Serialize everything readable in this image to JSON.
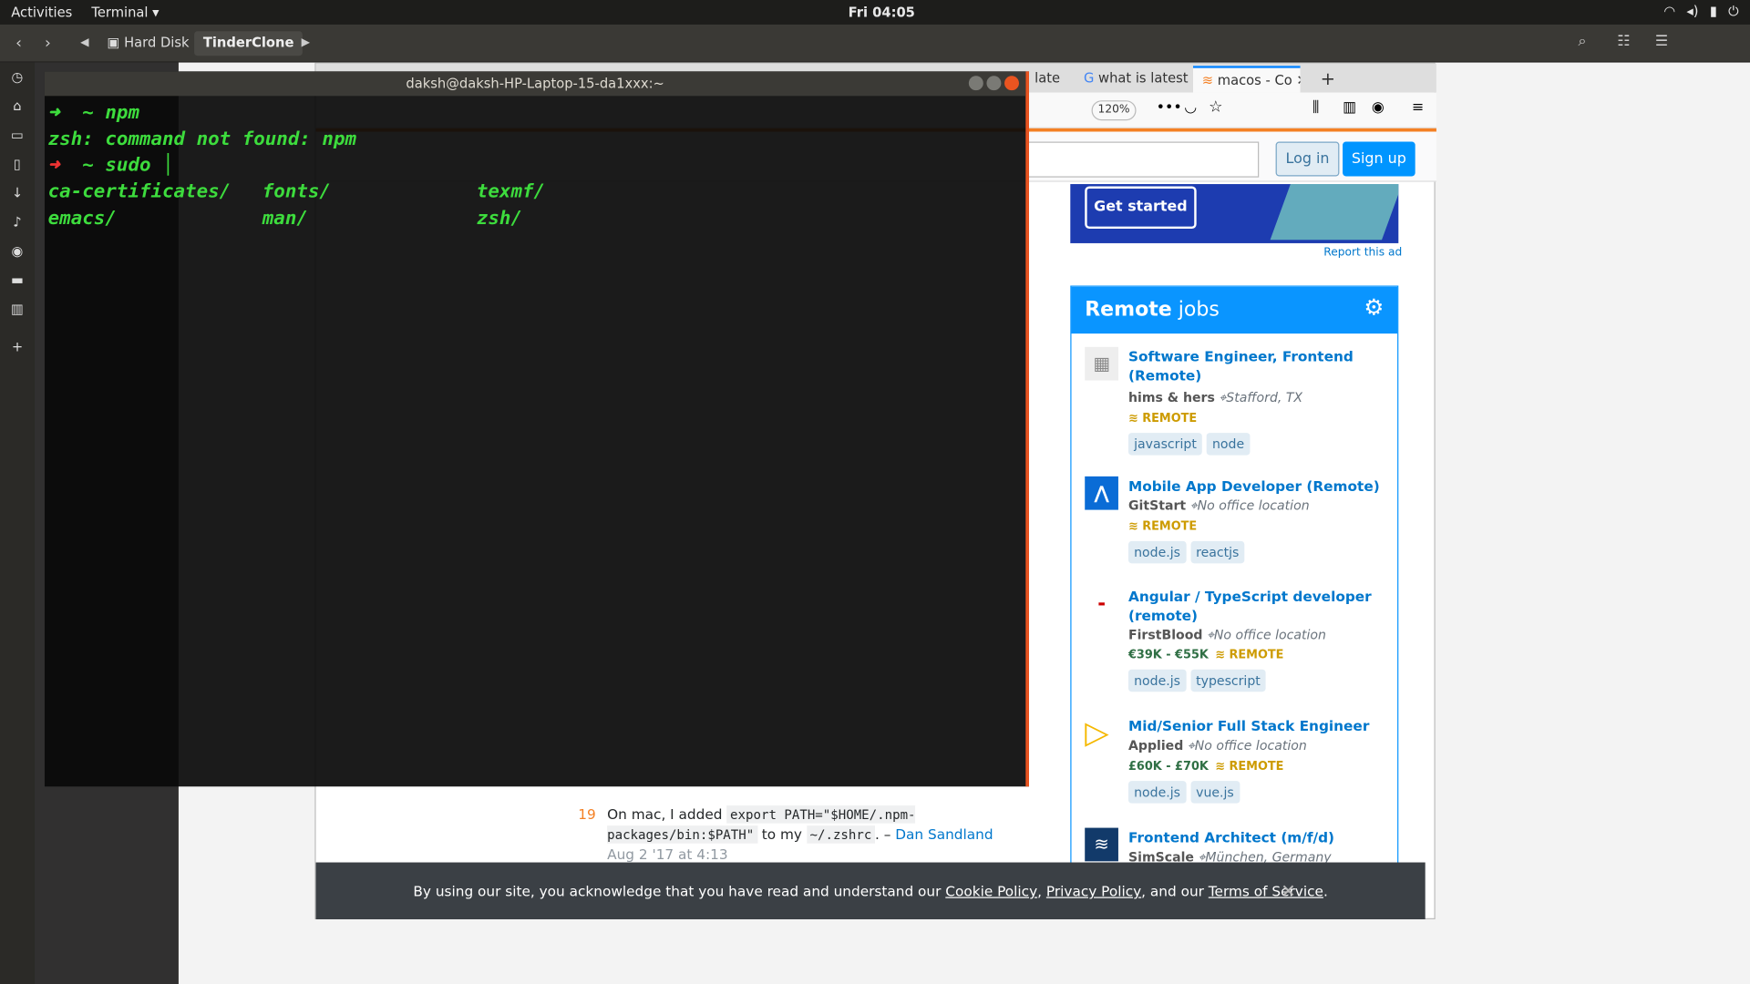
{
  "topbar": {
    "activities": "Activities",
    "app": "Terminal ▾",
    "clock": "Fri 04:05"
  },
  "filemanager": {
    "crumbs": [
      "Hard Disk",
      "TinderClone"
    ],
    "sidebar": [
      "Pictures",
      "Videos",
      "Trash",
      "Other Locations"
    ]
  },
  "browser": {
    "tabs": [
      "late",
      "what is latest",
      "macos - Co"
    ],
    "zoom": "120%",
    "login": "Log in",
    "signup": "Sign up",
    "ad": {
      "cta": "Get started",
      "report": "Report this ad"
    },
    "jobs": {
      "title_bold": "Remote",
      "title_rest": " jobs",
      "items": [
        {
          "title": "Software Engineer, Frontend (Remote)",
          "company": "hims & hers",
          "location": "Stafford, TX",
          "salary": "",
          "remote": "REMOTE",
          "tags": [
            "javascript",
            "node"
          ]
        },
        {
          "title": "Mobile App Developer (Remote)",
          "company": "GitStart",
          "location": "No office location",
          "salary": "",
          "remote": "REMOTE",
          "tags": [
            "node.js",
            "reactjs"
          ]
        },
        {
          "title": "Angular / TypeScript developer (remote)",
          "company": "FirstBlood",
          "location": "No office location",
          "salary": "€39K - €55K",
          "remote": "REMOTE",
          "tags": [
            "node.js",
            "typescript"
          ]
        },
        {
          "title": "Mid/Senior Full Stack Engineer",
          "company": "Applied",
          "location": "No office location",
          "salary": "£60K - £70K",
          "remote": "REMOTE",
          "tags": [
            "node.js",
            "vue.js"
          ]
        },
        {
          "title": "Frontend Architect (m/f/d)",
          "company": "SimScale",
          "location": "München, Germany",
          "salary": "",
          "remote": "",
          "tags": []
        }
      ]
    },
    "comment": {
      "votes": "19",
      "pre": "On mac, I added ",
      "code1": "export PATH=\"$HOME/.npm-packages/bin:$PATH\"",
      "mid": " to my ",
      "code2": "~/.zshrc",
      "dash": ". – ",
      "author": "Dan Sandland",
      "date": "Aug 2 '17 at 4:13"
    },
    "cookie": {
      "pre": "By using our site, you acknowledge that you have read and understand our ",
      "cookie": "Cookie Policy",
      "sep": ", ",
      "privacy": "Privacy Policy",
      "and": ", and our ",
      "terms": "Terms of Service",
      "end": "."
    }
  },
  "terminal": {
    "title": "daksh@daksh-HP-Laptop-15-da1xxx:~",
    "prompt_arrow": "➜",
    "tilde": "~",
    "cmd1": "npm",
    "err": "zsh: command not found: npm",
    "cmd2": "sudo",
    "dirs": [
      "ca-certificates/",
      "fonts/",
      "texmf/",
      "emacs/",
      "man/",
      "zsh/"
    ]
  }
}
